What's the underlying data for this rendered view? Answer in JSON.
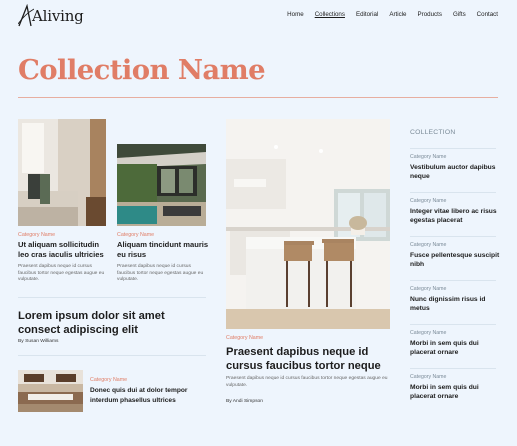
{
  "brand": {
    "logo_text": "Aliving"
  },
  "nav": {
    "items": [
      "Home",
      "Collections",
      "Editorial",
      "Article",
      "Products",
      "Gifts",
      "Contact"
    ],
    "active": "Collections"
  },
  "page_title": "Collection Name",
  "articles": [
    {
      "category": "Category Name",
      "title": "Ut aliquam sollicitudin leo cras iaculis ultricies",
      "excerpt": "Praesent dapibus neque id cursus faucibus tortor neque egestas augue eu vulputate."
    },
    {
      "category": "Category Name",
      "title": "Aliquam tincidunt mauris eu risus",
      "excerpt": "Praesent dapibus neque id cursus faucibus tortor neque egestas augue eu vulputate."
    },
    {
      "title": "Lorem ipsum dolor sit amet consect adipiscing elit",
      "author": "By Susan Williams"
    },
    {
      "category": "Category Name",
      "title": "Donec quis dui at dolor tempor interdum phasellus ultrices"
    }
  ],
  "featured": {
    "category": "Category Name",
    "title": "Praesent dapibus neque id cursus faucibus tortor neque",
    "excerpt": "Praesent dapibus neque id cursus faucibus tortor neque egestas augue eu vulputate.",
    "author": "By Andi Simpson"
  },
  "sidebar": {
    "heading": "COLLECTION",
    "items": [
      {
        "category": "Category Name",
        "title": "Vestibulum auctor dapibus neque"
      },
      {
        "category": "Category Name",
        "title": "Integer vitae libero ac risus egestas placerat"
      },
      {
        "category": "Category Name",
        "title": "Fusce pellentesque suscipit nibh"
      },
      {
        "category": "Category Name",
        "title": "Nunc dignissim risus id metus"
      },
      {
        "category": "Category Name",
        "title": "Morbi in sem quis dui placerat ornare"
      },
      {
        "category": "Category Name",
        "title": "Morbi in sem quis dui placerat ornare"
      }
    ]
  }
}
